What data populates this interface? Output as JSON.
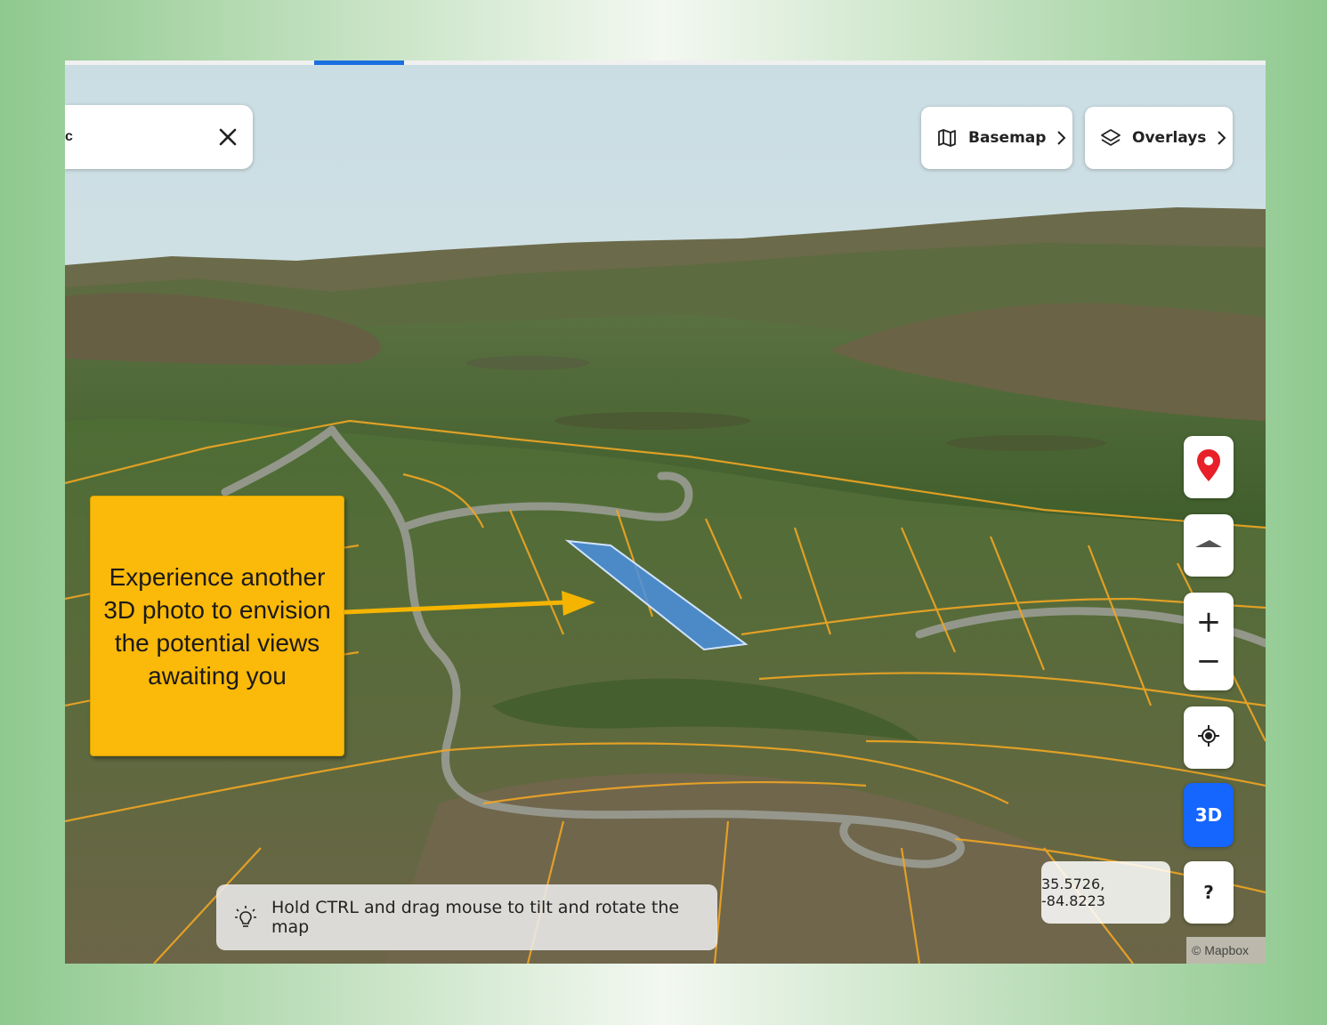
{
  "search": {
    "query": "c",
    "close_icon": "close-icon"
  },
  "toolbar": {
    "basemap_label": "Basemap",
    "overlays_label": "Overlays",
    "basemap_icon": "map-icon",
    "overlays_icon": "layers-icon"
  },
  "controls": {
    "zoom_in": "+",
    "zoom_out": "−",
    "three_d_label": "3D",
    "help_label": "?"
  },
  "coordinates": "35.5726, -84.8223",
  "hint": {
    "text": "Hold CTRL and drag mouse to tilt and rotate the map",
    "icon": "lightbulb-icon"
  },
  "attribution": "© Mapbox",
  "callout": {
    "text": "Experience another 3D photo to envision the potential views awaiting you"
  },
  "colors": {
    "accent": "#1565ff",
    "callout_bg": "#fbb909",
    "parcel_lines": "#f0a623",
    "parcel_highlight": "#4a8fe0",
    "pin": "#e8202a"
  }
}
